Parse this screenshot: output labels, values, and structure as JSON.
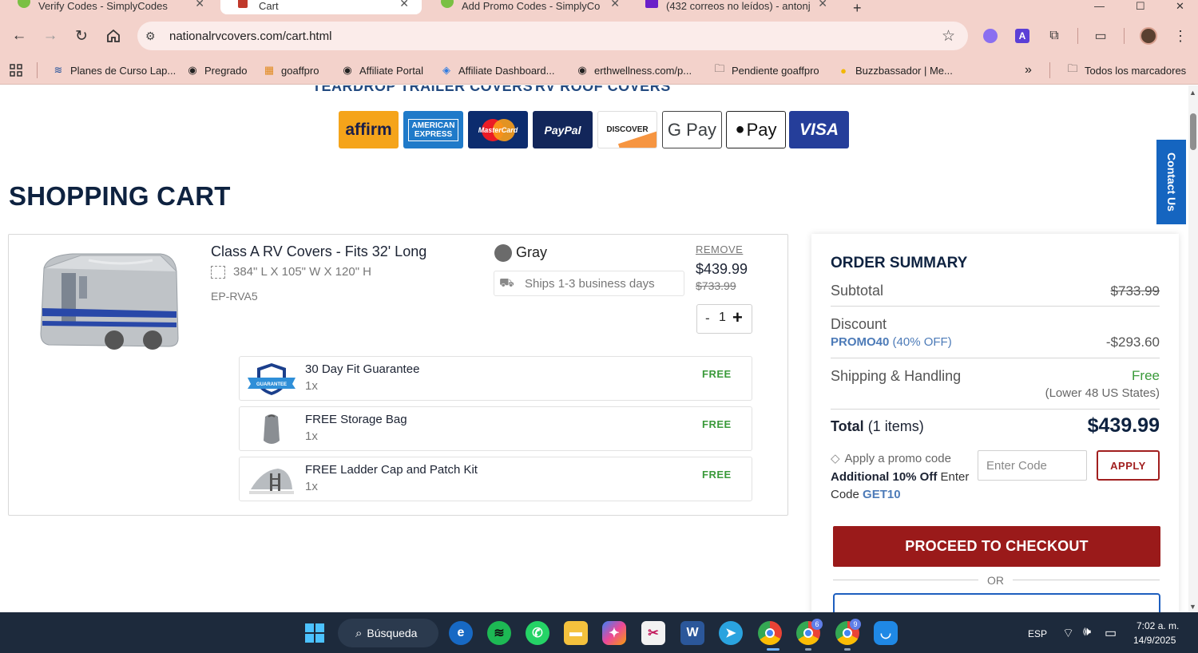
{
  "browser": {
    "tabs": [
      {
        "label": "Verify Codes - SimplyCodes"
      },
      {
        "label": "Cart"
      },
      {
        "label": "Add Promo Codes - SimplyCo"
      },
      {
        "label": "(432 correos no leídos) - antonj"
      }
    ],
    "url": "nationalrvcovers.com/cart.html",
    "bookmarks": [
      {
        "label": "Planes de Curso Lap..."
      },
      {
        "label": "Pregrado"
      },
      {
        "label": "goaffpro"
      },
      {
        "label": "Affiliate Portal"
      },
      {
        "label": "Affiliate Dashboard..."
      },
      {
        "label": "erthwellness.com/p..."
      },
      {
        "label": "Pendiente goaffpro"
      },
      {
        "label": "Buzzbassador | Me..."
      }
    ],
    "bookmarks_overflow": "»",
    "all_bookmarks": "Todos los marcadores"
  },
  "page": {
    "top_nav": [
      "TEARDROP TRAILER COVERS",
      "RV ROOF COVERS"
    ],
    "payments": [
      "affirm",
      "AMERICAN EXPRESS",
      "MasterCard",
      "PayPal",
      "DISCOVER",
      "G Pay",
      "Pay",
      "VISA"
    ],
    "cart_title": "SHOPPING CART",
    "product": {
      "name": "Class A RV Covers - Fits 32' Long",
      "dimensions": "384\" L X 105\" W X 120\" H",
      "sku": "EP-RVA5",
      "color": "Gray",
      "ships": "Ships 1-3 business days",
      "remove": "REMOVE",
      "price": "$439.99",
      "old_price": "$733.99",
      "qty_minus": "-",
      "qty": "1",
      "qty_plus": "+"
    },
    "gifts": [
      {
        "name": "30 Day Fit Guarantee",
        "qty": "1x",
        "price": "FREE",
        "badge": "GUARANTEE"
      },
      {
        "name": "FREE Storage Bag",
        "qty": "1x",
        "price": "FREE"
      },
      {
        "name": "FREE Ladder Cap and Patch Kit",
        "qty": "1x",
        "price": "FREE"
      }
    ],
    "summary": {
      "title": "ORDER SUMMARY",
      "subtotal_label": "Subtotal",
      "subtotal_value": "$733.99",
      "discount_label": "Discount",
      "promo_code": "PROMO40",
      "promo_pct": "(40% OFF)",
      "discount_value": "-$293.60",
      "shipping_label": "Shipping & Handling",
      "shipping_value": "Free",
      "shipping_note": "(Lower 48 US States)",
      "total_label": "Total",
      "total_items": "(1 items)",
      "total_value": "$439.99",
      "apply_promo": "Apply a promo code",
      "additional": "Additional 10% Off",
      "enter_code_text": "Enter Code",
      "get10": "GET10",
      "code_placeholder": "Enter Code",
      "apply_button": "APPLY",
      "checkout_button": "PROCEED TO CHECKOUT",
      "or": "OR"
    },
    "contact_us": "Contact Us"
  },
  "taskbar": {
    "search": "Búsqueda",
    "lang": "ESP",
    "time": "7:02 a. m.",
    "date": "14/9/2025",
    "badges": [
      "6",
      "9"
    ]
  },
  "colors": {
    "chrome_bg": "#f3d2cb",
    "brand_navy": "#0e2240",
    "checkout_red": "#9a1a1a",
    "free_green": "#3a9a3a",
    "promo_blue": "#4d7bb8",
    "contact_blue": "#1565c0"
  }
}
